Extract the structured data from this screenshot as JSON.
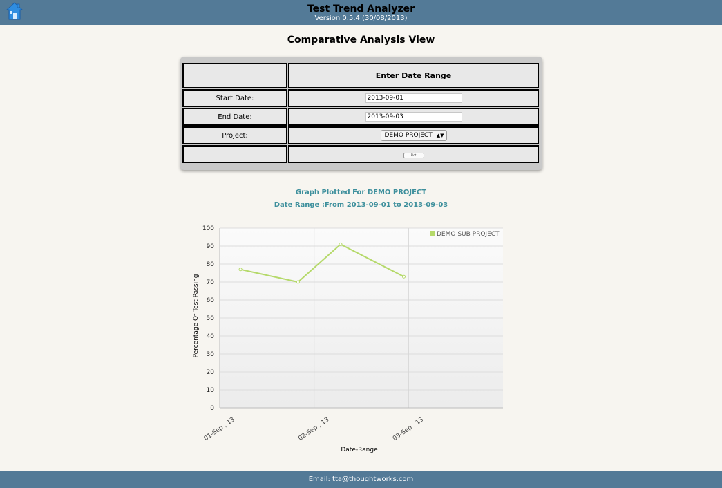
{
  "header": {
    "title": "Test Trend Analyzer",
    "version": "Version 0.5.4 (30/08/2013)",
    "home_icon": "home-icon"
  },
  "page": {
    "title": "Comparative Analysis View"
  },
  "form": {
    "header": "Enter Date Range",
    "start_label": "Start Date:",
    "start_value": "2013-09-01",
    "end_label": "End Date:",
    "end_value": "2013-09-03",
    "project_label": "Project:",
    "project_value": "DEMO PROJECT",
    "plot_label": "Plot"
  },
  "graph": {
    "title": "Graph Plotted For DEMO PROJECT",
    "range": "Date Range :From 2013-09-01 to 2013-09-03"
  },
  "chart_data": {
    "type": "line",
    "title": "",
    "xlabel": "Date-Range",
    "ylabel": "Percentage Of Test Passing",
    "ylim": [
      0,
      100
    ],
    "yticks": [
      "0",
      "10",
      "20",
      "30",
      "40",
      "50",
      "60",
      "70",
      "80",
      "90",
      "100"
    ],
    "categories": [
      "01-Sep , 13",
      "02-Sep , 13",
      "03-Sep , 13"
    ],
    "series": [
      {
        "name": "DEMO SUB PROJECT",
        "color": "#b5d96a",
        "points": [
          {
            "x": 0.22,
            "y": 77
          },
          {
            "x": 0.83,
            "y": 70
          },
          {
            "x": 1.28,
            "y": 91
          },
          {
            "x": 1.95,
            "y": 73
          }
        ]
      }
    ],
    "grid": true,
    "legend": "top-right"
  },
  "footer": {
    "email": "Email: tta@thoughtworks.com"
  }
}
